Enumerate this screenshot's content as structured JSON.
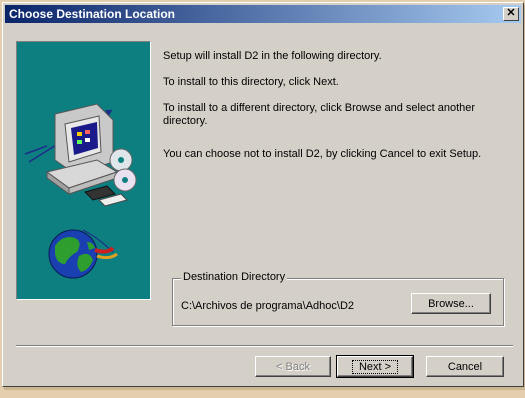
{
  "window": {
    "title": "Choose Destination Location"
  },
  "info": {
    "line1": "Setup will install D2 in the following directory.",
    "line2": "To install to this directory, click Next.",
    "line3": "To install to a different directory, click Browse and select another directory.",
    "line4": "You can choose not to install D2, by clicking Cancel to exit Setup."
  },
  "destination": {
    "group_label": "Destination Directory",
    "path": "C:\\Archivos de programa\\Adhoc\\D2",
    "browse_label": "Browse..."
  },
  "buttons": {
    "back": "< Back",
    "next": "Next >",
    "cancel": "Cancel"
  },
  "colors": {
    "art_background": "#0d7f80",
    "title_start": "#0a246a",
    "title_end": "#a6caf0"
  }
}
